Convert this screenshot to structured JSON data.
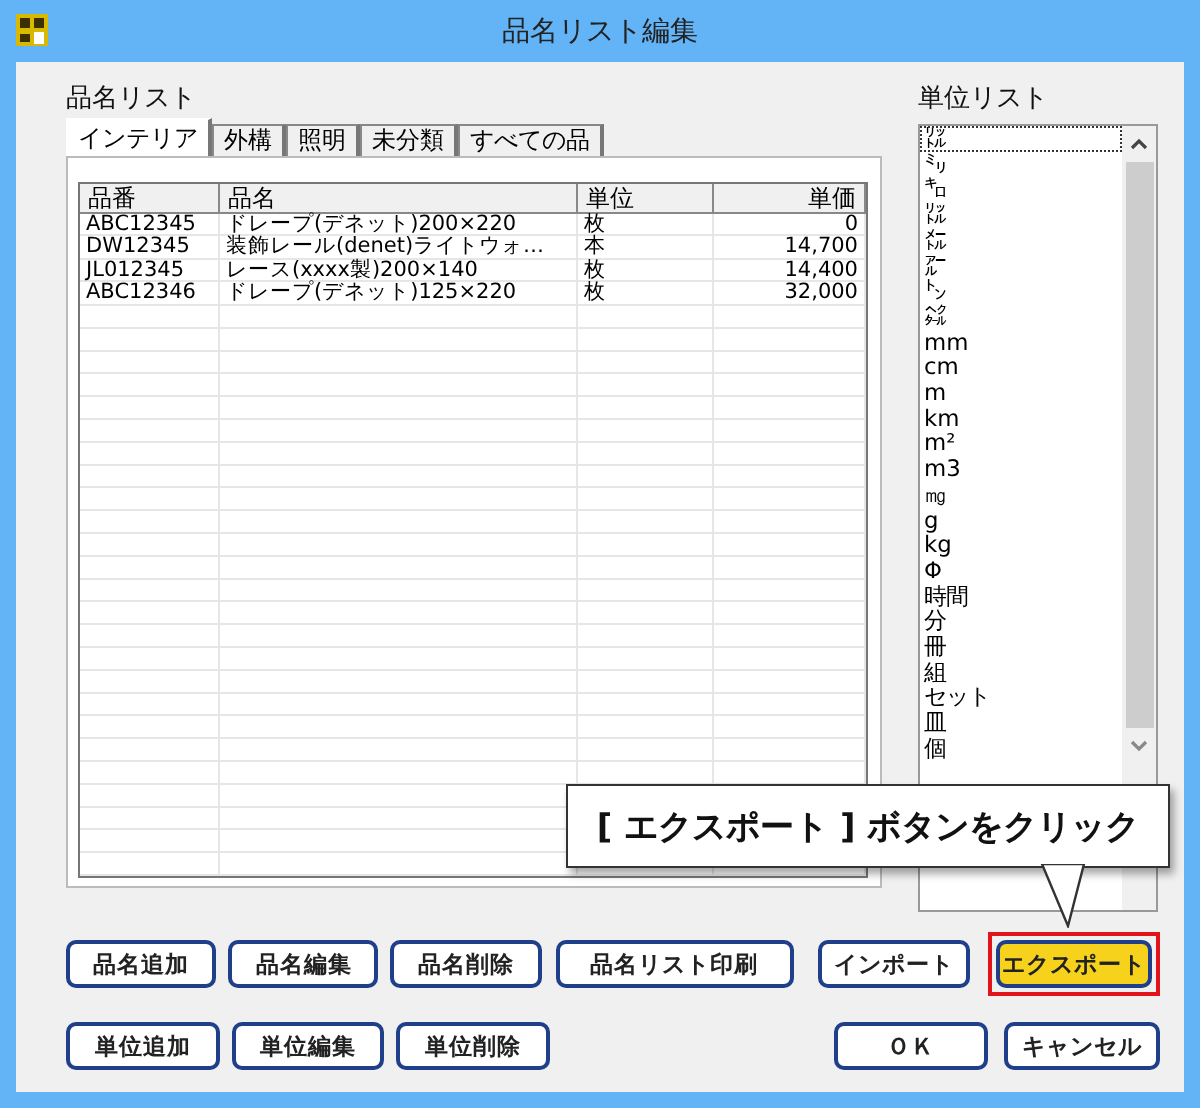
{
  "window": {
    "title": "品名リスト編集"
  },
  "items_panel": {
    "label": "品名リスト",
    "tabs": [
      {
        "label": "インテリア",
        "selected": true
      },
      {
        "label": "外構",
        "selected": false
      },
      {
        "label": "照明",
        "selected": false
      },
      {
        "label": "未分類",
        "selected": false
      },
      {
        "label": "すべての品",
        "selected": false
      }
    ],
    "table": {
      "columns": [
        "品番",
        "品名",
        "単位",
        "単価"
      ],
      "rows": [
        [
          "ABC12345",
          "ドレープ(デネット)200×220",
          "枚",
          "0"
        ],
        [
          "DW12345",
          "装飾レール(denet)ライトウォ…",
          "本",
          "14,700"
        ],
        [
          "JL012345",
          "レース(xxxx製)200×140",
          "枚",
          "14,400"
        ],
        [
          "ABC12346",
          "ドレープ(デネット)125×220",
          "枚",
          "32,000"
        ]
      ]
    }
  },
  "units_panel": {
    "label": "単位リスト",
    "items": [
      {
        "label": "㍑",
        "selected": true
      },
      {
        "label": "㍉",
        "selected": false
      },
      {
        "label": "㌔",
        "selected": false
      },
      {
        "label": "㍑",
        "selected": false
      },
      {
        "label": "㍍",
        "selected": false
      },
      {
        "label": "㌃",
        "selected": false
      },
      {
        "label": "㌧",
        "selected": false
      },
      {
        "label": "㌶",
        "selected": false
      },
      {
        "label": "mm",
        "selected": false
      },
      {
        "label": "cm",
        "selected": false
      },
      {
        "label": "m",
        "selected": false
      },
      {
        "label": "km",
        "selected": false
      },
      {
        "label": "m²",
        "selected": false
      },
      {
        "label": "m3",
        "selected": false
      },
      {
        "label": "㎎",
        "selected": false
      },
      {
        "label": "g",
        "selected": false
      },
      {
        "label": "kg",
        "selected": false
      },
      {
        "label": "Φ",
        "selected": false
      },
      {
        "label": "時間",
        "selected": false
      },
      {
        "label": "分",
        "selected": false
      },
      {
        "label": "冊",
        "selected": false
      },
      {
        "label": "組",
        "selected": false
      },
      {
        "label": "セット",
        "selected": false
      },
      {
        "label": "皿",
        "selected": false
      },
      {
        "label": "個",
        "selected": false
      }
    ]
  },
  "button_rows": [
    [
      {
        "label": "品名追加",
        "highlighted": false
      },
      {
        "label": "品名編集",
        "highlighted": false
      },
      {
        "label": "品名削除",
        "highlighted": false
      },
      {
        "label": "品名リスト印刷",
        "highlighted": false
      },
      {
        "label": "インポート",
        "highlighted": false
      },
      {
        "label": "エクスポート",
        "highlighted": true
      }
    ],
    [
      {
        "label": "単位追加",
        "highlighted": false
      },
      {
        "label": "単位編集",
        "highlighted": false
      },
      {
        "label": "単位削除",
        "highlighted": false
      },
      {
        "label": "ＯＫ",
        "highlighted": false
      },
      {
        "label": "キャンセル",
        "highlighted": false
      }
    ]
  ],
  "callout": {
    "text": "[ エクスポート ] ボタンをクリック"
  }
}
